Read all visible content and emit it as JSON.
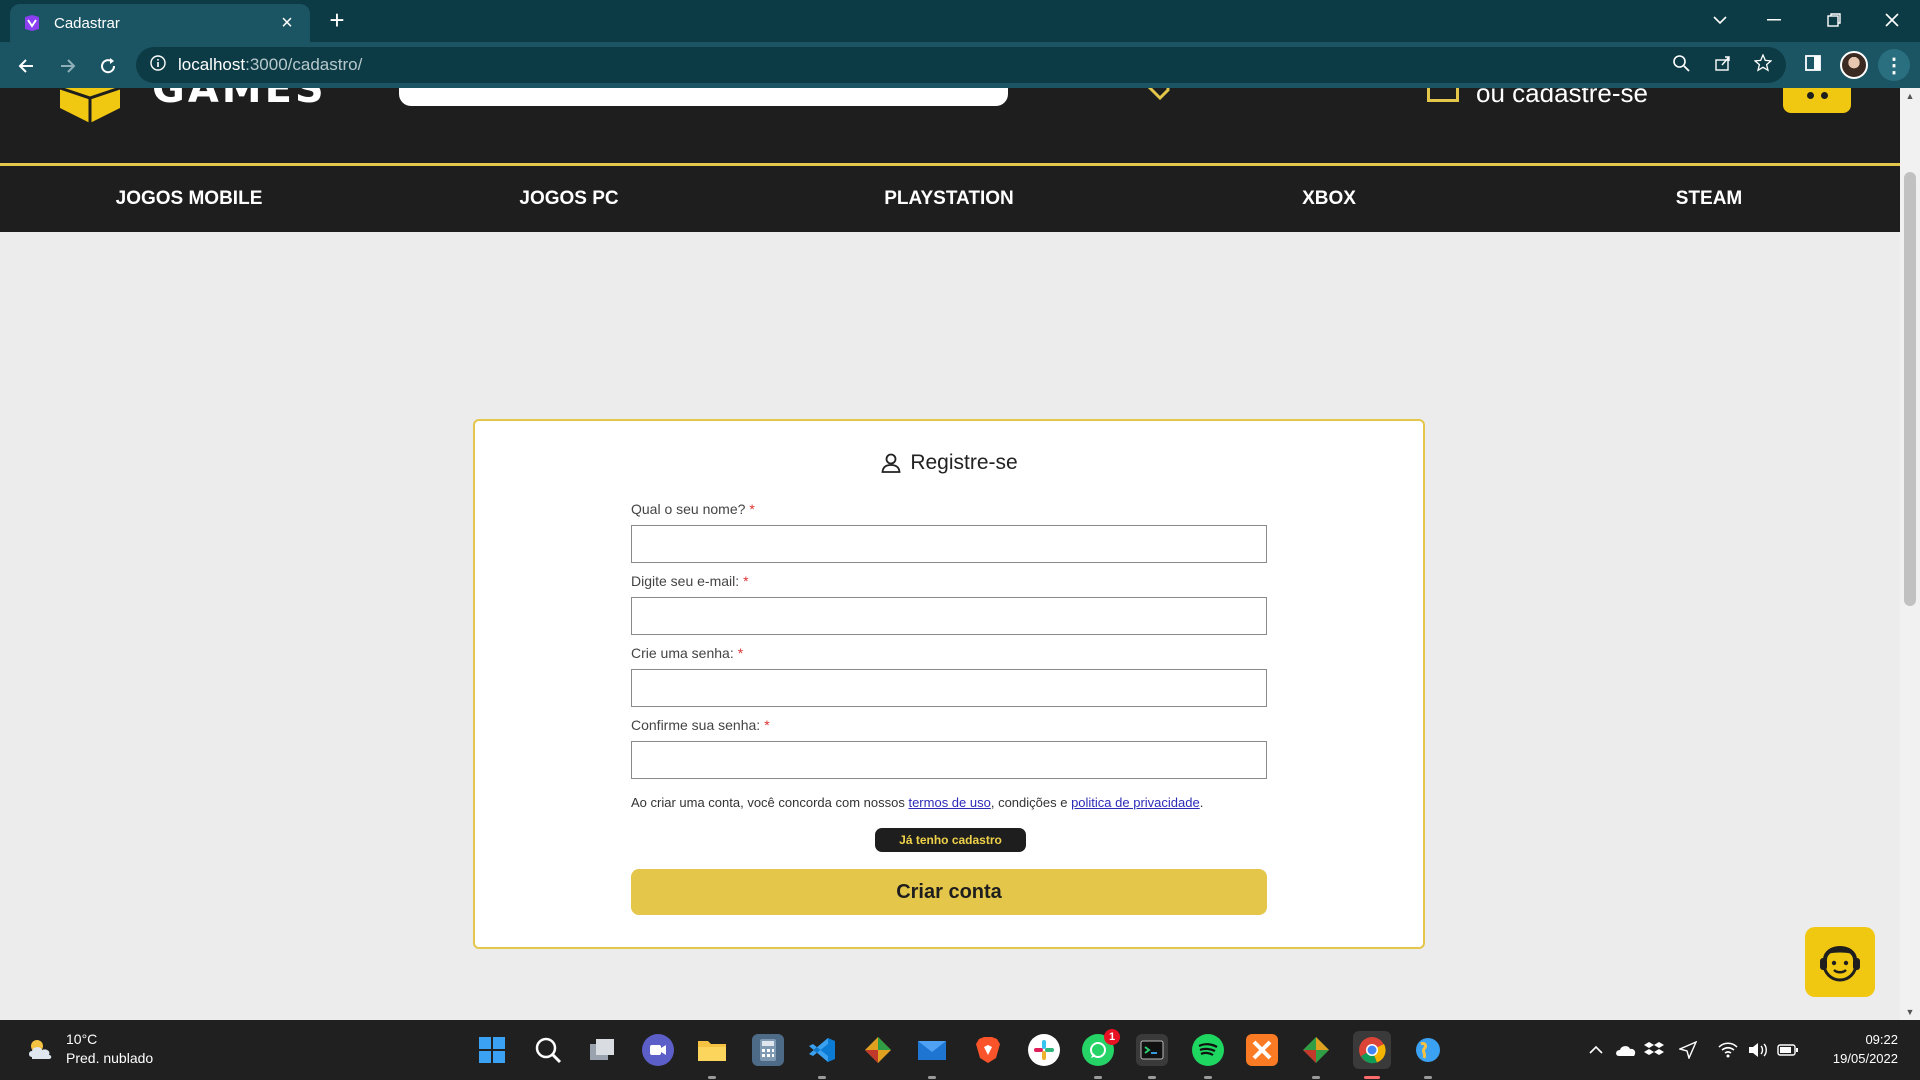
{
  "browser": {
    "tab_title": "Cadastrar",
    "tab_close": "×",
    "new_tab": "+",
    "url_host": "localhost",
    "url_path": ":3000/cadastro/"
  },
  "header": {
    "logo_text": "GAMES",
    "login_text": "ou cadastre-se"
  },
  "categories": [
    "JOGOS MOBILE",
    "JOGOS PC",
    "PLAYSTATION",
    "XBOX",
    "STEAM"
  ],
  "form": {
    "title": "Registre-se",
    "required_mark": "*",
    "fields": [
      {
        "label": "Qual o seu nome?",
        "value": ""
      },
      {
        "label": "Digite seu e-mail:",
        "value": ""
      },
      {
        "label": "Crie uma senha:",
        "value": ""
      },
      {
        "label": "Confirme sua senha:",
        "value": ""
      }
    ],
    "terms_prefix": "Ao criar uma conta, você concorda com nossos ",
    "terms_link": "termos de uso",
    "terms_middle": ", condições e ",
    "privacy_link": "politica de privacidade",
    "terms_suffix": ".",
    "have_account_button": "Já tenho cadastro",
    "submit_button": "Criar conta"
  },
  "taskbar": {
    "weather_temp": "10°C",
    "weather_desc": "Pred. nublado",
    "whatsapp_badge": "1",
    "time": "09:22",
    "date": "19/05/2022"
  },
  "colors": {
    "accent": "#e3c64a",
    "header_bg": "#1e1e1e",
    "page_bg": "#ececec",
    "browser_bg": "#0d3b45"
  }
}
